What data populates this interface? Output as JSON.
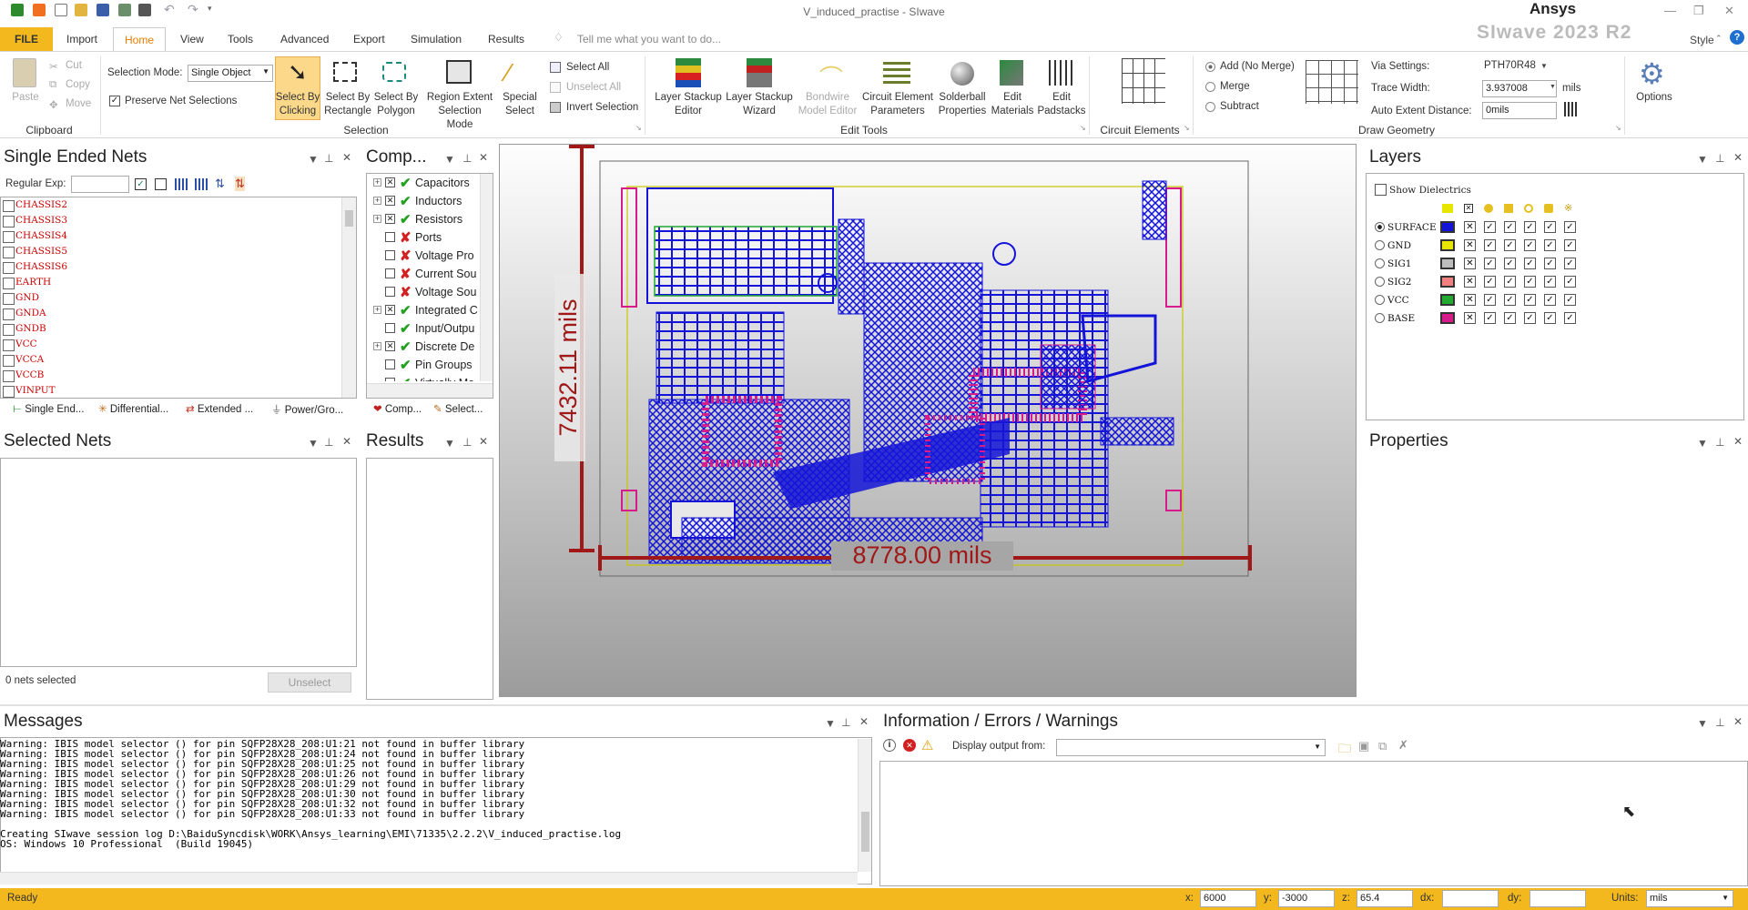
{
  "window": {
    "title": "V_induced_practise - SIwave",
    "brand": "Ansys",
    "product": "SIwave 2023 R2",
    "style_label": "Style"
  },
  "tabs": [
    "FILE",
    "Import",
    "Home",
    "View",
    "Tools",
    "Advanced",
    "Export",
    "Simulation",
    "Results"
  ],
  "tell_me": "Tell me what you want to do...",
  "ribbon": {
    "clipboard": {
      "paste": "Paste",
      "cut": "Cut",
      "copy": "Copy",
      "move": "Move",
      "group": "Clipboard"
    },
    "selection": {
      "mode_label": "Selection Mode:",
      "mode_value": "Single Object",
      "preserve": "Preserve Net Selections",
      "buttons": [
        "Select By Clicking",
        "Select By Rectangle",
        "Select By Polygon",
        "Region Extent Selection Mode",
        "Special Select"
      ],
      "select_all": "Select All",
      "unselect_all": "Unselect All",
      "invert": "Invert Selection",
      "group": "Selection"
    },
    "edit_tools": {
      "buttons": [
        "Layer Stackup Editor",
        "Layer Stackup Wizard",
        "Bondwire Model Editor",
        "Circuit Element Parameters",
        "Solderball Properties",
        "Edit Materials",
        "Edit Padstacks"
      ],
      "group": "Edit Tools"
    },
    "circuit_elements": {
      "group": "Circuit Elements"
    },
    "draw": {
      "add": "Add (No Merge)",
      "merge": "Merge",
      "subtract": "Subtract",
      "via_label": "Via Settings:",
      "via_value": "PTH70R48",
      "trace_label": "Trace Width:",
      "trace_value": "3.937008",
      "trace_unit": "mils",
      "auto_label": "Auto Extent Distance:",
      "auto_value": "0mils",
      "group": "Draw Geometry"
    },
    "options": "Options"
  },
  "single_ended_nets": {
    "title": "Single Ended Nets",
    "regex_label": "Regular Exp:",
    "nets": [
      "CHASSIS2",
      "CHASSIS3",
      "CHASSIS4",
      "CHASSIS5",
      "CHASSIS6",
      "EARTH",
      "GND",
      "GNDA",
      "GNDB",
      "VCC",
      "VCCA",
      "VCCB",
      "VINPUT"
    ],
    "tabs": [
      "Single End...",
      "Differential...",
      "Extended ...",
      "Power/Gro..."
    ]
  },
  "components": {
    "title": "Comp...",
    "items": [
      {
        "label": "Capacitors",
        "mark": "ok",
        "tree": "+"
      },
      {
        "label": "Inductors",
        "mark": "ok",
        "tree": "+"
      },
      {
        "label": "Resistors",
        "mark": "ok",
        "tree": "+"
      },
      {
        "label": "Ports",
        "mark": "no",
        "tree": ""
      },
      {
        "label": "Voltage Pro",
        "mark": "no",
        "tree": ""
      },
      {
        "label": "Current Sou",
        "mark": "no",
        "tree": ""
      },
      {
        "label": "Voltage Sou",
        "mark": "no",
        "tree": ""
      },
      {
        "label": "Integrated C",
        "mark": "ok",
        "tree": "+"
      },
      {
        "label": "Input/Outpu",
        "mark": "ok",
        "tree": ""
      },
      {
        "label": "Discrete De",
        "mark": "ok",
        "tree": "+"
      },
      {
        "label": "Pin Groups",
        "mark": "ok",
        "tree": ""
      },
      {
        "label": "Virtually Mo",
        "mark": "ok",
        "tree": ""
      }
    ],
    "tabs": [
      "Comp...",
      "Select..."
    ]
  },
  "selected_nets": {
    "title": "Selected Nets",
    "count": "0 nets selected",
    "unselect": "Unselect"
  },
  "results": {
    "title": "Results"
  },
  "canvas": {
    "dim_vertical": "7432.11 mils",
    "dim_horizontal": "8778.00 mils"
  },
  "layers": {
    "title": "Layers",
    "show_dielectrics": "Show Dielectrics",
    "rows": [
      {
        "name": "SURFACE",
        "color": "#1414d8",
        "selected": true
      },
      {
        "name": "GND",
        "color": "#e6e600",
        "selected": false
      },
      {
        "name": "SIG1",
        "color": "#bdbdbd",
        "selected": false
      },
      {
        "name": "SIG2",
        "color": "#f08080",
        "selected": false
      },
      {
        "name": "VCC",
        "color": "#22aa33",
        "selected": false
      },
      {
        "name": "BASE",
        "color": "#d81b8a",
        "selected": false
      }
    ]
  },
  "properties": {
    "title": "Properties"
  },
  "messages": {
    "title": "Messages",
    "lines": [
      "Warning: IBIS model selector () for pin SQFP28X28_208:U1:21 not found in buffer library",
      "Warning: IBIS model selector () for pin SQFP28X28_208:U1:24 not found in buffer library",
      "Warning: IBIS model selector () for pin SQFP28X28_208:U1:25 not found in buffer library",
      "Warning: IBIS model selector () for pin SQFP28X28_208:U1:26 not found in buffer library",
      "Warning: IBIS model selector () for pin SQFP28X28_208:U1:29 not found in buffer library",
      "Warning: IBIS model selector () for pin SQFP28X28_208:U1:30 not found in buffer library",
      "Warning: IBIS model selector () for pin SQFP28X28_208:U1:32 not found in buffer library",
      "Warning: IBIS model selector () for pin SQFP28X28_208:U1:33 not found in buffer library",
      "",
      "Creating SIwave session log D:\\BaiduSyncdisk\\WORK\\Ansys_learning\\EMI\\71335\\2.2.2\\V_induced_practise.log",
      "OS: Windows 10 Professional  (Build 19045)"
    ]
  },
  "info": {
    "title": "Information / Errors / Warnings",
    "display_label": "Display output from:"
  },
  "status": {
    "ready": "Ready",
    "x_label": "x:",
    "x": "6000",
    "y_label": "y:",
    "y": "-3000",
    "z_label": "z:",
    "z": "65.4",
    "dx_label": "dx:",
    "dy_label": "dy:",
    "units_label": "Units:",
    "units": "mils"
  }
}
